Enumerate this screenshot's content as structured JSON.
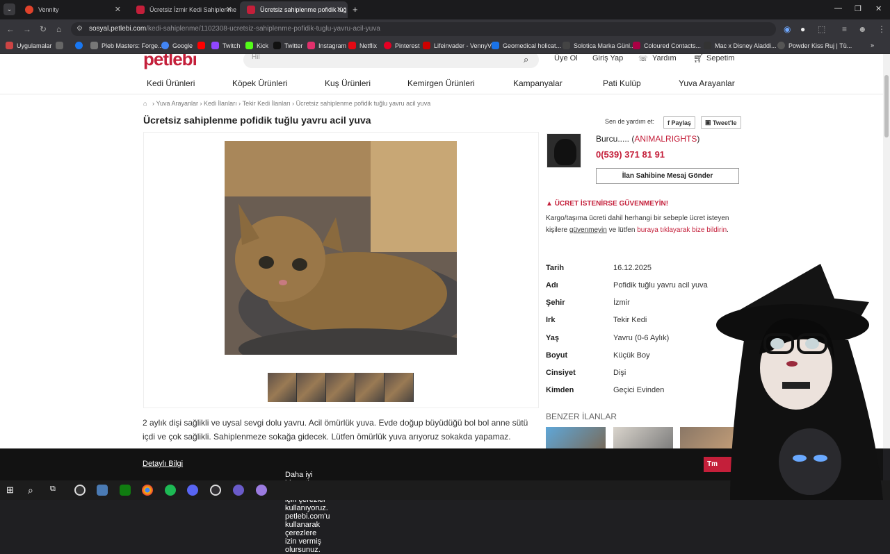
{
  "browser": {
    "tabs": [
      {
        "label": "Vennity",
        "color": "#e0422b"
      },
      {
        "label": "Ücretsiz İzmir Kedi Sahiplenme",
        "color": "#c41f3a"
      },
      {
        "label": "Ücretsiz sahiplenme pofidik tuğ",
        "color": "#c41f3a"
      }
    ],
    "new_tab": "+",
    "url_host": "sosyal.petlebi.com",
    "url_path": "/kedi-sahiplenme/1102308-ucretsiz-sahiplenme-pofidik-tuglu-yavru-acil-yuva",
    "bookmarks": [
      {
        "label": "Uygulamalar",
        "color": "#888"
      },
      {
        "label": "Pleb Masters: Forge...",
        "color": "#777"
      },
      {
        "label": "Google",
        "color": "#4285f4"
      },
      {
        "label": "Twitch",
        "color": "#9146ff"
      },
      {
        "label": "Kick",
        "color": "#53fc18"
      },
      {
        "label": "Twitter",
        "color": "#000"
      },
      {
        "label": "Instagram",
        "color": "#e1306c"
      },
      {
        "label": "Netflix",
        "color": "#e50914"
      },
      {
        "label": "Pinterest",
        "color": "#e60023"
      },
      {
        "label": "Lifeinvader - VennyV",
        "color": "#c00"
      },
      {
        "label": "Geomedical holicat...",
        "color": "#1a73e8"
      },
      {
        "label": "Solotica Marka Günl...",
        "color": "#444"
      },
      {
        "label": "Coloured Contacts...",
        "color": "#a04"
      },
      {
        "label": "Mac x Disney Aladdi...",
        "color": "#333"
      },
      {
        "label": "Powder Kiss Ruj | Tü...",
        "color": "#555"
      }
    ]
  },
  "site": {
    "logo": "petlebi",
    "search_placeholder": "Hil",
    "top_links": [
      "Üye Ol",
      "Giriş Yap",
      "Yardım",
      "Sepetim"
    ],
    "categories": [
      "Kedi Ürünleri",
      "Köpek Ürünleri",
      "Kuş Ürünleri",
      "Kemirgen Ürünleri",
      "Kampanyalar",
      "Pati Kulüp",
      "Yuva Arayanlar"
    ],
    "breadcrumb": [
      "Yuva Arayanlar",
      "Kedi İlanları",
      "Tekir Kedi İlanları",
      "Ücretsiz sahiplenme pofidik tuğlu yavru acil yuva"
    ],
    "title": "Ücretsiz sahiplenme pofidik tuğlu yavru acil yuva",
    "share_text": "Sen de yardım et:",
    "share_fb": "Paylaş",
    "share_tw": "Tweet'le",
    "owner_name": "Burcu.....",
    "owner_org": "ANIMALRIGHTS",
    "phone": "0(539) 371 81 91",
    "message_button": "İlan Sahibine Mesaj Gönder",
    "warning_title": "ÜCRET İSTENİRSE GÜVENMEYİN!",
    "warning_text_1": "Kargo/taşıma ücreti dahil herhangi bir sebeple ücret isteyen kişilere ",
    "warning_link_1": "güvenmeyin",
    "warning_text_2": " ve lütfen ",
    "warning_link_2": "buraya tıklayarak bize bildirin",
    "warning_text_3": ".",
    "details": [
      {
        "label": "Tarih",
        "value": "16.12.2025"
      },
      {
        "label": "Adı",
        "value": "Pofidik tuğlu yavru acil yuva"
      },
      {
        "label": "Şehir",
        "value": "İzmir"
      },
      {
        "label": "Irk",
        "value": "Tekir Kedi"
      },
      {
        "label": "Yaş",
        "value": "Yavru (0-6 Aylık)"
      },
      {
        "label": "Boyut",
        "value": "Küçük Boy"
      },
      {
        "label": "Cinsiyet",
        "value": "Dişi"
      },
      {
        "label": "Kimden",
        "value": "Geçici Evinden"
      }
    ],
    "description": "2 aylık dişi sağlikli ve uysal sevgi dolu yavru. Acil ömürlük yuva. Evde doğup büyüdüğü bol bol anne sütü içdi ve çok sağlikli. Sahiplenmeze sokağa gidecek. Lütfen ömürlük yuva arıyoruz sokakda yapamaz.",
    "similar_title": "BENZER İLANLAR",
    "cookie_text": "Daha iyi hizmetler sunabilmek için çerezler kullanıyoruz. petlebi.com'u kullanarak çerezlere izin vermiş olursunuz. ",
    "cookie_link": "Detaylı Bilgi",
    "cookie_button": "Tm",
    "brand_color": "#c41f3a"
  }
}
